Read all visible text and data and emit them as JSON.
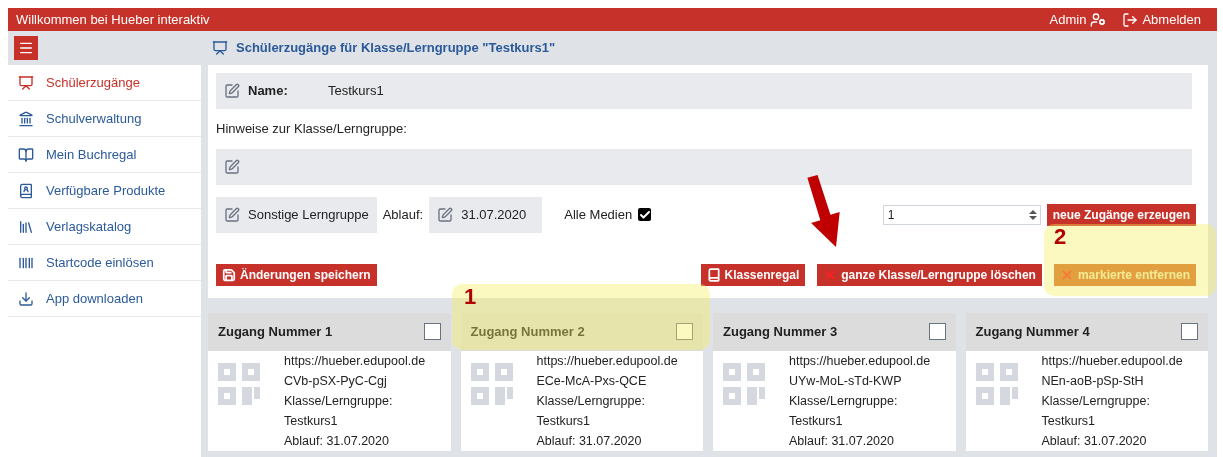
{
  "header": {
    "title": "Willkommen bei Hueber interaktiv",
    "user": "Admin",
    "logout": "Abmelden"
  },
  "sidebar": {
    "items": [
      {
        "label": "Schülerzugänge",
        "selected": true
      },
      {
        "label": "Schulverwaltung",
        "selected": false
      },
      {
        "label": "Mein Buchregal",
        "selected": false
      },
      {
        "label": "Verfügbare Produkte",
        "selected": false
      },
      {
        "label": "Verlagskatalog",
        "selected": false
      },
      {
        "label": "Startcode einlösen",
        "selected": false
      },
      {
        "label": "App downloaden",
        "selected": false
      }
    ]
  },
  "page_title": "Schülerzugänge für Klasse/Lerngruppe \"Testkurs1\"",
  "form": {
    "name_label": "Name:",
    "name_value": "Testkurs1",
    "notes_label": "Hinweise zur Klasse/Lerngruppe:",
    "group_type": "Sonstige Lerngruppe",
    "expiry_label": "Ablauf:",
    "expiry_value": "31.07.2020",
    "all_media_label": "Alle Medien",
    "all_media_checked": true,
    "count_value": "1",
    "create_button": "neue Zugänge erzeugen"
  },
  "actions": [
    {
      "label": "Änderungen speichern"
    },
    {
      "label": "Klassenregal"
    },
    {
      "label": "ganze Klasse/Lerngruppe löschen"
    },
    {
      "label": "markierte entfernen"
    }
  ],
  "cards": [
    {
      "title": "Zugang Nummer 1",
      "checked": false,
      "url": "https://hueber.edupool.de",
      "code": "CVb-pSX-PyC-Cgj",
      "group_label": "Klasse/Lerngruppe:",
      "group": "Testkurs1",
      "expiry": "Ablauf: 31.07.2020"
    },
    {
      "title": "Zugang Nummer 2",
      "checked": false,
      "url": "https://hueber.edupool.de",
      "code": "ECe-McA-Pxs-QCE",
      "group_label": "Klasse/Lerngruppe:",
      "group": "Testkurs1",
      "expiry": "Ablauf: 31.07.2020"
    },
    {
      "title": "Zugang Nummer 3",
      "checked": false,
      "url": "https://hueber.edupool.de",
      "code": "UYw-MoL-sTd-KWP",
      "group_label": "Klasse/Lerngruppe:",
      "group": "Testkurs1",
      "expiry": "Ablauf: 31.07.2020"
    },
    {
      "title": "Zugang Nummer 4",
      "checked": false,
      "url": "https://hueber.edupool.de",
      "code": "NEn-aoB-pSp-StH",
      "group_label": "Klasse/Lerngruppe:",
      "group": "Testkurs1",
      "expiry": "Ablauf: 31.07.2020"
    }
  ],
  "annotations": [
    {
      "label": "1"
    },
    {
      "label": "2"
    }
  ]
}
